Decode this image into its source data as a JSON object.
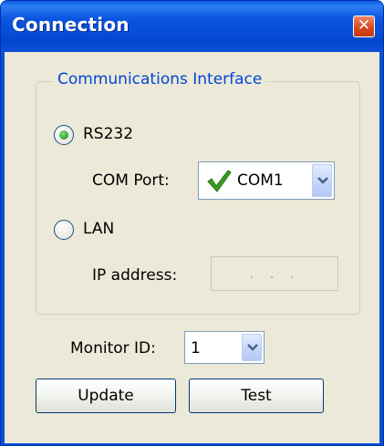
{
  "window": {
    "title": "Connection",
    "close_symbol": "✕"
  },
  "group": {
    "legend": "Communications Interface"
  },
  "rs232": {
    "label": "RS232",
    "selected": true
  },
  "com_port": {
    "label": "COM Port:",
    "value": "COM1",
    "status_icon": "green-checkmark-icon"
  },
  "lan": {
    "label": "LAN",
    "selected": false
  },
  "ip": {
    "label": "IP address:",
    "value": ". . ."
  },
  "monitor": {
    "label": "Monitor ID:",
    "value": "1"
  },
  "buttons": {
    "update": "Update",
    "test": "Test"
  },
  "colors": {
    "title_bar": "#0a4fd6",
    "dialog_face": "#ece9d8",
    "legend_text": "#0046d5",
    "close_button": "#d9451a",
    "radio_selected": "#2fa22a",
    "checkmark": "#3aa020"
  }
}
